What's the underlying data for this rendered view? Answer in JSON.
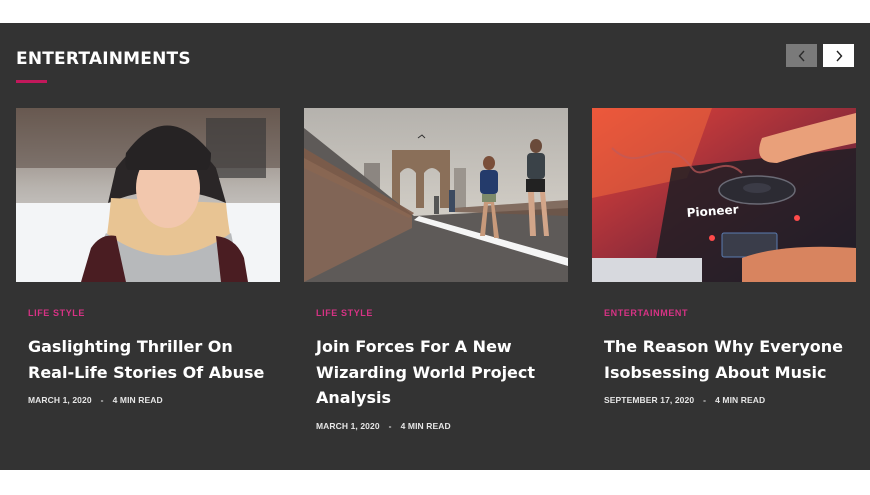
{
  "section": {
    "title": "ENTERTAINMENTS",
    "accent_color": "#c2185b",
    "prev_icon": "chevron-left-icon",
    "next_icon": "chevron-right-icon"
  },
  "cards": [
    {
      "category": "LIFE STYLE",
      "title": "Gaslighting Thriller On Real-Life Stories Of Abuse",
      "date": "MARCH 1, 2020",
      "separator": "-",
      "read_time": "4 MIN READ"
    },
    {
      "category": "LIFE STYLE",
      "title": "Join Forces For A New Wizarding World Project Analysis",
      "date": "MARCH 1, 2020",
      "separator": "-",
      "read_time": "4 MIN READ"
    },
    {
      "category": "ENTERTAINMENT",
      "title": "The Reason Why Everyone Isobsessing About Music",
      "date": "SEPTEMBER 17, 2020",
      "separator": "-",
      "read_time": "4 MIN READ",
      "image_text": "Pioneer"
    }
  ]
}
